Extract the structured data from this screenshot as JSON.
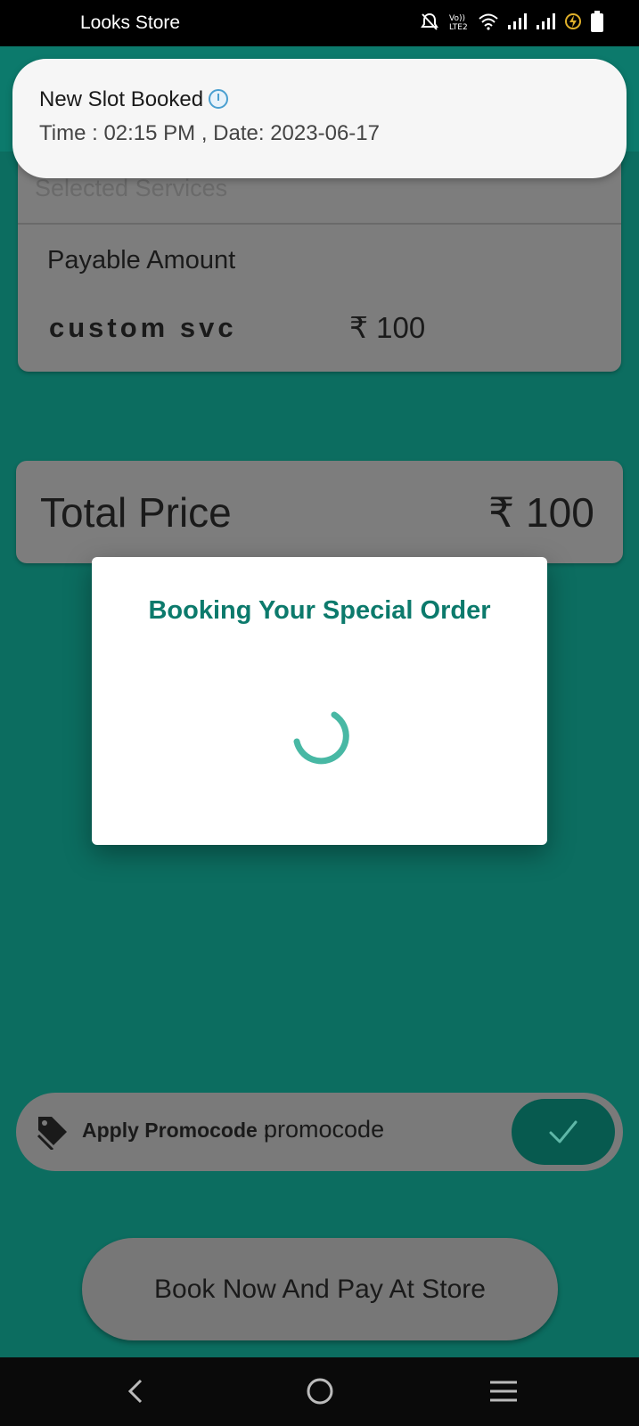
{
  "status_bar": {
    "app_name": "Looks Store",
    "icons": [
      "mute-icon",
      "volte-icon",
      "wifi-icon",
      "signal-icon",
      "signal-icon",
      "charging-icon",
      "battery-icon"
    ]
  },
  "notification": {
    "title": "New Slot Booked",
    "body": "Time : 02:15 PM , Date: 2023-06-17",
    "icon": "stopwatch-icon"
  },
  "services": {
    "header": "Selected Services",
    "payable_label": "Payable Amount",
    "items": [
      {
        "name": "custom svc",
        "price": "₹ 100"
      }
    ]
  },
  "total": {
    "label": "Total Price",
    "value": "₹ 100"
  },
  "dialog": {
    "title": "Booking Your Special Order",
    "state": "loading"
  },
  "promo": {
    "label": "Apply Promocode :",
    "value": "promocode",
    "icon": "tag-icon",
    "apply_icon": "check-icon"
  },
  "book_button": {
    "label": "Book Now And Pay At Store"
  },
  "nav_bar": {
    "icons": [
      "back-icon",
      "home-icon",
      "menu-icon"
    ]
  },
  "colors": {
    "primary": "#0c7a6c",
    "accent": "#48b8a4",
    "background": "#0c6d60"
  }
}
